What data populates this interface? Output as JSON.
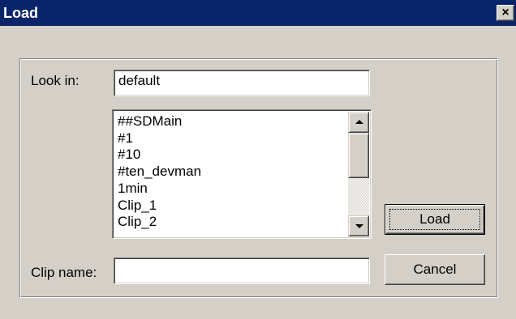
{
  "window": {
    "title": "Load",
    "close_glyph": "×"
  },
  "colors": {
    "titlebar": "#0a246a",
    "face": "#d4d0c8",
    "field": "#ffffff"
  },
  "look_in": {
    "label": "Look in:",
    "value": "default"
  },
  "file_list": {
    "items": [
      "##SDMain",
      "#1",
      "#10",
      "#ten_devman",
      "1min",
      "Clip_1",
      "Clip_2"
    ],
    "scroll_position": 0.0
  },
  "clip_name": {
    "label": "Clip name:",
    "value": ""
  },
  "buttons": {
    "load_label": "Load",
    "cancel_label": "Cancel"
  },
  "icons": {
    "close": "close-icon",
    "scroll_up": "chevron-up-icon",
    "scroll_down": "chevron-down-icon"
  }
}
